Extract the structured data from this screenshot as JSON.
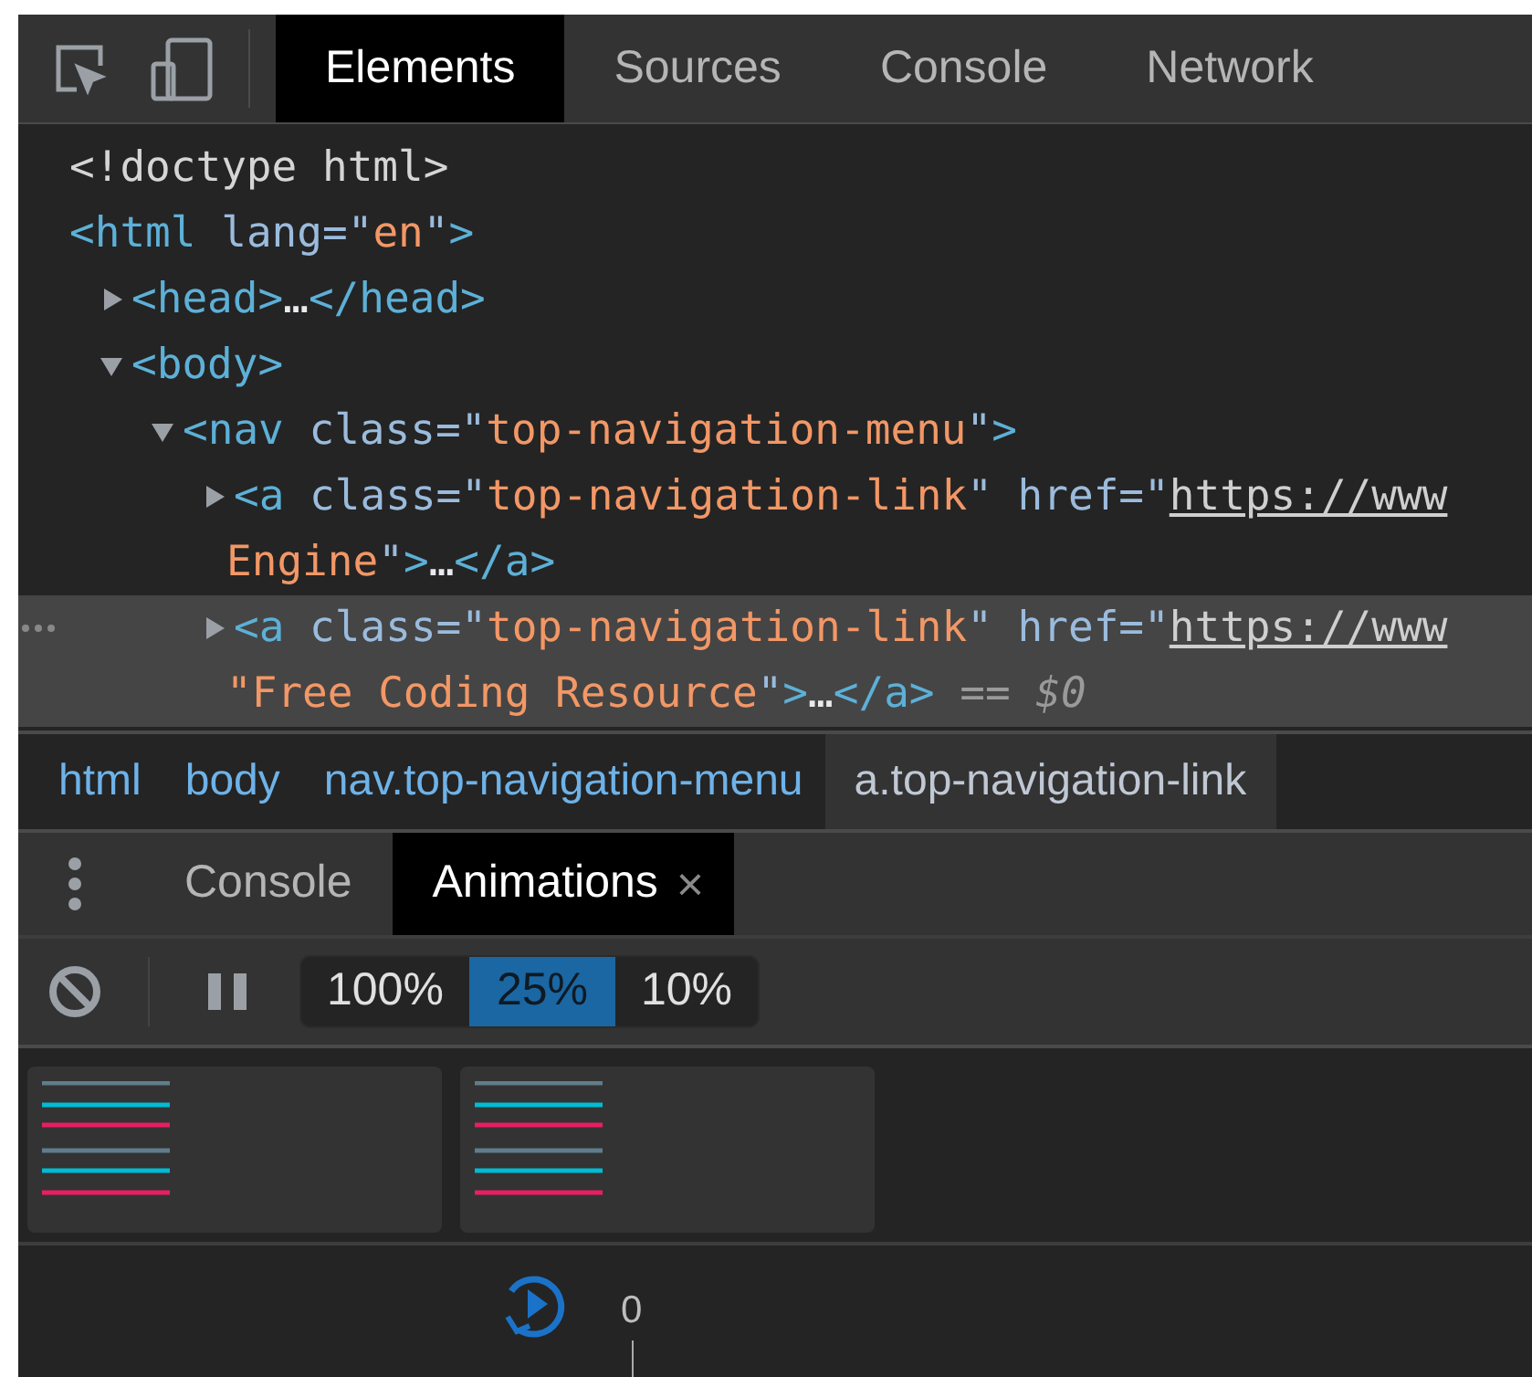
{
  "top_tabs": [
    {
      "label": "Elements",
      "selected": true
    },
    {
      "label": "Sources",
      "selected": false
    },
    {
      "label": "Console",
      "selected": false
    },
    {
      "label": "Network",
      "selected": false
    }
  ],
  "dom_tree": [
    {
      "selected": false,
      "lines": [
        [
          {
            "kind": "plain",
            "text": "<!doctype html>"
          }
        ]
      ]
    },
    {
      "selected": false,
      "lines": [
        [
          {
            "kind": "tag",
            "text": "<html"
          },
          {
            "kind": "attr",
            "text": " lang=\""
          },
          {
            "kind": "value",
            "text": "en"
          },
          {
            "kind": "attr",
            "text": "\""
          },
          {
            "kind": "tag",
            "text": ">"
          }
        ]
      ],
      "children": [
        {
          "expanded": false,
          "selected": false,
          "lines": [
            [
              {
                "kind": "tag",
                "text": "<head>"
              },
              {
                "kind": "text",
                "text": "…"
              },
              {
                "kind": "tag",
                "text": "</head>"
              }
            ]
          ]
        },
        {
          "expanded": true,
          "selected": false,
          "lines": [
            [
              {
                "kind": "tag",
                "text": "<body>"
              }
            ]
          ],
          "children": [
            {
              "expanded": true,
              "selected": false,
              "lines": [
                [
                  {
                    "kind": "tag",
                    "text": "<nav"
                  },
                  {
                    "kind": "attr",
                    "text": " class=\""
                  },
                  {
                    "kind": "value",
                    "text": "top-navigation-menu"
                  },
                  {
                    "kind": "attr",
                    "text": "\""
                  },
                  {
                    "kind": "tag",
                    "text": ">"
                  }
                ]
              ],
              "children": [
                {
                  "expanded": false,
                  "selected": false,
                  "lines": [
                    [
                      {
                        "kind": "tag",
                        "text": "<a"
                      },
                      {
                        "kind": "attr",
                        "text": " class=\""
                      },
                      {
                        "kind": "value",
                        "text": "top-navigation-link"
                      },
                      {
                        "kind": "attr",
                        "text": "\" href=\""
                      },
                      {
                        "kind": "link",
                        "text": "https://www"
                      }
                    ],
                    [
                      {
                        "kind": "value",
                        "text": "Engine"
                      },
                      {
                        "kind": "attr",
                        "text": "\""
                      },
                      {
                        "kind": "tag",
                        "text": ">"
                      },
                      {
                        "kind": "text",
                        "text": "…"
                      },
                      {
                        "kind": "tag",
                        "text": "</a>"
                      }
                    ]
                  ]
                },
                {
                  "expanded": false,
                  "selected": true,
                  "lines": [
                    [
                      {
                        "kind": "tag",
                        "text": "<a"
                      },
                      {
                        "kind": "attr",
                        "text": " class=\""
                      },
                      {
                        "kind": "value",
                        "text": "top-navigation-link"
                      },
                      {
                        "kind": "attr",
                        "text": "\" href=\""
                      },
                      {
                        "kind": "link",
                        "text": "https://www"
                      }
                    ],
                    [
                      {
                        "kind": "value",
                        "text": "\"Free Coding Resource"
                      },
                      {
                        "kind": "attr",
                        "text": "\""
                      },
                      {
                        "kind": "tag",
                        "text": ">"
                      },
                      {
                        "kind": "text",
                        "text": "…"
                      },
                      {
                        "kind": "tag",
                        "text": "</a>"
                      },
                      {
                        "kind": "muted",
                        "text": " == "
                      },
                      {
                        "kind": "var",
                        "text": "$0"
                      }
                    ]
                  ]
                }
              ]
            }
          ]
        }
      ]
    }
  ],
  "breadcrumbs": [
    {
      "label": "html",
      "selected": false
    },
    {
      "label": "body",
      "selected": false
    },
    {
      "label": "nav.top-navigation-menu",
      "selected": false
    },
    {
      "label": "a.top-navigation-link",
      "selected": true
    }
  ],
  "drawer_tabs": [
    {
      "label": "Console",
      "selected": false,
      "closable": false
    },
    {
      "label": "Animations",
      "selected": true,
      "closable": true
    }
  ],
  "close_glyph": "×",
  "speeds": [
    {
      "label": "100%",
      "selected": false
    },
    {
      "label": "25%",
      "selected": true
    },
    {
      "label": "10%",
      "selected": false
    }
  ],
  "animation_groups": [
    {
      "selected": false
    },
    {
      "selected": false
    }
  ],
  "timeline": {
    "start": "0"
  }
}
